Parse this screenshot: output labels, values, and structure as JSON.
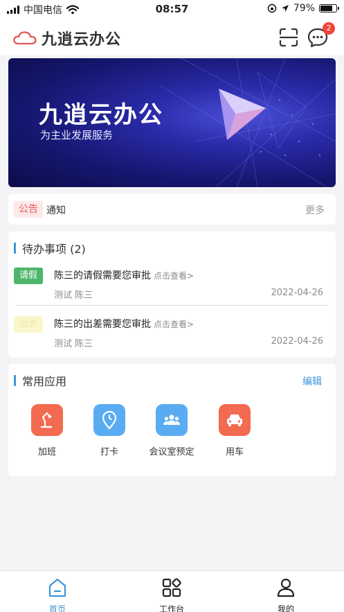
{
  "status_bar": {
    "carrier": "中国电信",
    "time": "08:57",
    "battery": "79%",
    "battery_level": 0.79
  },
  "header": {
    "app_title": "九逍云办公",
    "message_badge": "2",
    "icons": [
      "cloud-logo-icon",
      "scan-icon",
      "chat-icon"
    ]
  },
  "banner": {
    "title": "九逍云办公",
    "subtitle": "为主业发展服务"
  },
  "notice": {
    "tag": "公告",
    "text": "通知",
    "more": "更多"
  },
  "todo": {
    "title": "待办事项 (2)",
    "items": [
      {
        "tag": "请假",
        "text": "陈三的请假需要您审批",
        "link": "点击查看>",
        "meta": "测试 陈三",
        "date": "2022-04-26"
      },
      {
        "tag": "出差",
        "text": "陈三的出差需要您审批",
        "link": "点击查看>",
        "meta": "测试 陈三",
        "date": "2022-04-26"
      }
    ]
  },
  "apps": {
    "title": "常用应用",
    "edit": "编辑",
    "items": [
      {
        "label": "加班",
        "icon": "desk-lamp-icon",
        "color": "#f26a4f"
      },
      {
        "label": "打卡",
        "icon": "location-clock-icon",
        "color": "#5aacf2"
      },
      {
        "label": "会议室预定",
        "icon": "people-group-icon",
        "color": "#5aacf2"
      },
      {
        "label": "用车",
        "icon": "car-icon",
        "color": "#f26a4f"
      }
    ]
  },
  "tabbar": {
    "items": [
      {
        "label": "首页",
        "icon": "home-icon",
        "active": true
      },
      {
        "label": "工作台",
        "icon": "workbench-icon",
        "active": false
      },
      {
        "label": "我的",
        "icon": "user-icon",
        "active": false
      }
    ]
  },
  "colors": {
    "accent": "#3c95d8",
    "tab_active": "#3c95d8",
    "notice_tag_bg": "#fde8e8",
    "notice_tag_text": "#e45c5c",
    "badge": "#f0443a",
    "tag_green": "#4db66c"
  }
}
